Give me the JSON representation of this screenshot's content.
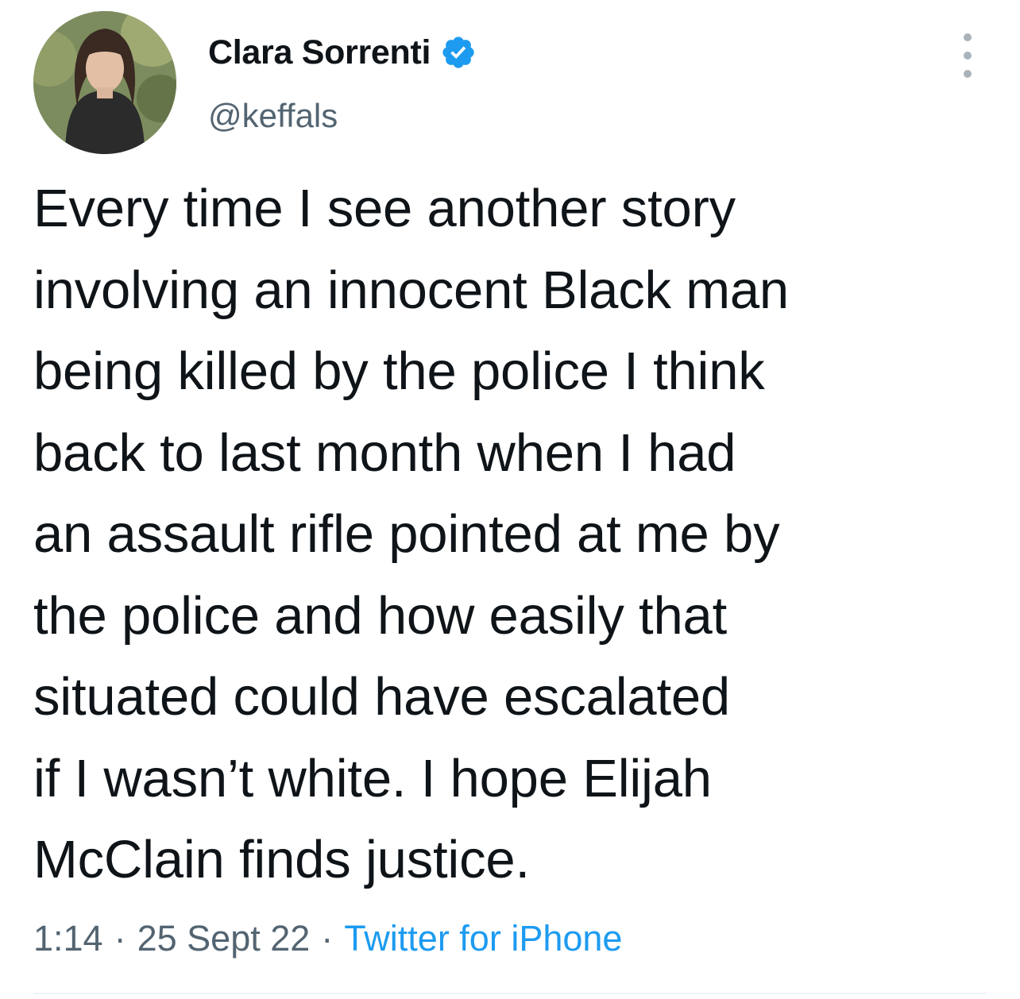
{
  "author": {
    "display_name": "Clara Sorrenti",
    "handle": "@keffals",
    "verified": true,
    "verified_badge_color": "#1d9bf0",
    "avatar_icon": "profile-photo"
  },
  "tweet": {
    "lines": [
      "Every time I see another story",
      "involving an innocent Black man",
      "being killed by the police I think",
      "back to last month when I had",
      "an assault rifle pointed at me by",
      "the police and how easily that",
      "situated could have escalated",
      "if I wasn’t white. I hope Elijah",
      "McClain finds justice."
    ]
  },
  "meta": {
    "time": "1:14",
    "date": "25 Sept 22",
    "separator": "·",
    "source": "Twitter for iPhone",
    "source_color": "#1d9bf0"
  },
  "menu_icon": "more-vertical-icon"
}
